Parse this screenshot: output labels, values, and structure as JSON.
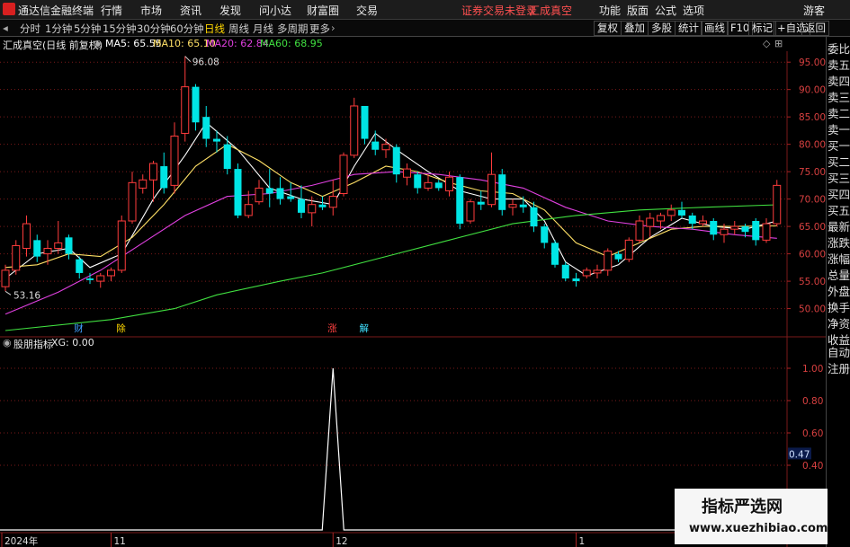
{
  "app_title": "通达信金融终端",
  "menu": [
    "行情",
    "市场",
    "资讯",
    "发现",
    "问小达",
    "财富圈",
    "交易"
  ],
  "menu_right": [
    "功能",
    "版面",
    "公式",
    "选项"
  ],
  "guest": "游客",
  "warning": "证券交易未登录",
  "stock_name_top": "汇成真空",
  "periods": [
    "分时",
    "1分钟",
    "5分钟",
    "15分钟",
    "30分钟",
    "60分钟",
    "日线",
    "周线",
    "月线",
    "多周期",
    "更多"
  ],
  "active_period": "日线",
  "right_buttons": [
    "复权",
    "叠加",
    "多股",
    "统计",
    "画线",
    "F10",
    "标记",
    "+自选",
    "返回"
  ],
  "chart_title": "汇成真空(日线 前复权)",
  "ma_legend": [
    {
      "label": "MA5: 65.55",
      "color": "#ffffff"
    },
    {
      "label": "MA10: 65.10",
      "color": "#ffe066"
    },
    {
      "label": "MA20: 62.84",
      "color": "#e040e0"
    },
    {
      "label": "MA60: 68.95",
      "color": "#40e040"
    }
  ],
  "side_panel": [
    "委比",
    "卖五",
    "卖四",
    "卖三",
    "卖二",
    "卖一",
    "买一",
    "买二",
    "买三",
    "买四",
    "买五",
    "最新",
    "涨跌",
    "涨幅",
    "总量",
    "外盘",
    "换手",
    "净资",
    "收益"
  ],
  "side_panel_lower": [
    "自动",
    "注册"
  ],
  "indicator_title": "股朋指标",
  "indicator_value": "XG: 0.00",
  "price_axis": [
    "95.00",
    "90.00",
    "85.00",
    "80.00",
    "75.00",
    "70.00",
    "65.00",
    "60.00",
    "55.00",
    "50.00"
  ],
  "indicator_axis": [
    "1.00",
    "0.80",
    "0.60",
    "0.40"
  ],
  "indicator_current": "0.47",
  "max_label": "96.08",
  "min_label": "53.16",
  "date_labels": [
    "2024年",
    "11",
    "12",
    "1"
  ],
  "event_markers": [
    {
      "text": "财",
      "color": "#40a0ff"
    },
    {
      "text": "除",
      "color": "#ffd700"
    },
    {
      "text": "涨",
      "color": "#ff4040"
    },
    {
      "text": "解",
      "color": "#40e0ff"
    }
  ],
  "watermark": {
    "line1": "指标严选网",
    "line2": "www.xuezhibiao.com"
  },
  "colors": {
    "up": "#ff3c3c",
    "down": "#00e5e5",
    "grid": "#7a1a1a"
  },
  "chart_data": {
    "type": "candlestick",
    "price_range": [
      45.5,
      97
    ],
    "candles": [
      {
        "o": 54.0,
        "h": 58.0,
        "l": 53.16,
        "c": 57.0
      },
      {
        "o": 57.0,
        "h": 62.5,
        "l": 56.2,
        "c": 61.5
      },
      {
        "o": 61.0,
        "h": 67.0,
        "l": 59.5,
        "c": 65.5
      },
      {
        "o": 62.5,
        "h": 63.5,
        "l": 58.5,
        "c": 59.5
      },
      {
        "o": 60.0,
        "h": 62.5,
        "l": 58.0,
        "c": 61.0
      },
      {
        "o": 61.0,
        "h": 66.0,
        "l": 60.0,
        "c": 62.0
      },
      {
        "o": 63.0,
        "h": 63.5,
        "l": 59.0,
        "c": 60.0
      },
      {
        "o": 59.0,
        "h": 59.5,
        "l": 55.5,
        "c": 56.5
      },
      {
        "o": 55.5,
        "h": 56.5,
        "l": 54.5,
        "c": 55.2
      },
      {
        "o": 55.0,
        "h": 56.5,
        "l": 53.8,
        "c": 56.0
      },
      {
        "o": 56.0,
        "h": 57.5,
        "l": 55.0,
        "c": 57.0
      },
      {
        "o": 57.0,
        "h": 67.0,
        "l": 56.5,
        "c": 66.0
      },
      {
        "o": 66.0,
        "h": 75.0,
        "l": 65.5,
        "c": 73.0
      },
      {
        "o": 72.0,
        "h": 74.5,
        "l": 71.0,
        "c": 73.5
      },
      {
        "o": 73.5,
        "h": 77.0,
        "l": 69.5,
        "c": 76.5
      },
      {
        "o": 76.0,
        "h": 78.5,
        "l": 71.0,
        "c": 72.0
      },
      {
        "o": 72.5,
        "h": 84.0,
        "l": 71.0,
        "c": 81.5
      },
      {
        "o": 82.0,
        "h": 96.08,
        "l": 80.5,
        "c": 90.5
      },
      {
        "o": 90.5,
        "h": 91.0,
        "l": 82.5,
        "c": 84.0
      },
      {
        "o": 85.0,
        "h": 87.0,
        "l": 79.5,
        "c": 81.0
      },
      {
        "o": 81.0,
        "h": 82.5,
        "l": 78.5,
        "c": 80.5
      },
      {
        "o": 80.0,
        "h": 81.5,
        "l": 74.5,
        "c": 75.5
      },
      {
        "o": 75.5,
        "h": 76.5,
        "l": 66.5,
        "c": 67.0
      },
      {
        "o": 67.0,
        "h": 71.5,
        "l": 66.5,
        "c": 69.0
      },
      {
        "o": 69.5,
        "h": 73.5,
        "l": 69.0,
        "c": 72.0
      },
      {
        "o": 72.0,
        "h": 75.5,
        "l": 68.5,
        "c": 71.0
      },
      {
        "o": 72.0,
        "h": 74.0,
        "l": 69.0,
        "c": 70.0
      },
      {
        "o": 70.5,
        "h": 73.0,
        "l": 69.5,
        "c": 70.0
      },
      {
        "o": 70.0,
        "h": 72.5,
        "l": 66.5,
        "c": 67.5
      },
      {
        "o": 67.5,
        "h": 70.5,
        "l": 65.0,
        "c": 69.0
      },
      {
        "o": 69.0,
        "h": 70.5,
        "l": 68.0,
        "c": 68.5
      },
      {
        "o": 68.5,
        "h": 73.5,
        "l": 67.0,
        "c": 70.5
      },
      {
        "o": 71.0,
        "h": 78.5,
        "l": 70.5,
        "c": 78.0
      },
      {
        "o": 78.0,
        "h": 88.5,
        "l": 77.5,
        "c": 87.0
      },
      {
        "o": 87.0,
        "h": 85.5,
        "l": 80.0,
        "c": 81.0
      },
      {
        "o": 80.5,
        "h": 82.5,
        "l": 78.0,
        "c": 79.0
      },
      {
        "o": 79.0,
        "h": 81.0,
        "l": 77.5,
        "c": 80.0
      },
      {
        "o": 79.5,
        "h": 80.0,
        "l": 73.0,
        "c": 74.5
      },
      {
        "o": 74.0,
        "h": 76.5,
        "l": 72.5,
        "c": 75.5
      },
      {
        "o": 74.5,
        "h": 75.0,
        "l": 71.0,
        "c": 72.0
      },
      {
        "o": 72.0,
        "h": 74.5,
        "l": 71.5,
        "c": 73.0
      },
      {
        "o": 73.0,
        "h": 73.5,
        "l": 71.5,
        "c": 72.0
      },
      {
        "o": 71.5,
        "h": 75.0,
        "l": 70.5,
        "c": 74.0
      },
      {
        "o": 74.0,
        "h": 74.5,
        "l": 64.5,
        "c": 65.5
      },
      {
        "o": 66.0,
        "h": 70.0,
        "l": 65.5,
        "c": 69.5
      },
      {
        "o": 69.5,
        "h": 71.5,
        "l": 68.0,
        "c": 69.0
      },
      {
        "o": 69.0,
        "h": 78.5,
        "l": 68.5,
        "c": 74.5
      },
      {
        "o": 74.5,
        "h": 75.5,
        "l": 67.0,
        "c": 68.0
      },
      {
        "o": 68.5,
        "h": 70.0,
        "l": 67.0,
        "c": 69.0
      },
      {
        "o": 69.0,
        "h": 70.5,
        "l": 67.5,
        "c": 68.5
      },
      {
        "o": 68.5,
        "h": 69.5,
        "l": 64.0,
        "c": 65.0
      },
      {
        "o": 65.0,
        "h": 65.5,
        "l": 61.0,
        "c": 62.0
      },
      {
        "o": 62.0,
        "h": 62.5,
        "l": 57.5,
        "c": 58.0
      },
      {
        "o": 58.0,
        "h": 58.5,
        "l": 55.0,
        "c": 55.5
      },
      {
        "o": 55.5,
        "h": 56.5,
        "l": 54.0,
        "c": 55.0
      },
      {
        "o": 56.0,
        "h": 57.5,
        "l": 55.5,
        "c": 57.0
      },
      {
        "o": 56.5,
        "h": 58.0,
        "l": 55.5,
        "c": 57.0
      },
      {
        "o": 57.0,
        "h": 61.0,
        "l": 56.0,
        "c": 60.5
      },
      {
        "o": 60.0,
        "h": 60.5,
        "l": 58.5,
        "c": 59.0
      },
      {
        "o": 59.0,
        "h": 63.0,
        "l": 58.5,
        "c": 62.5
      },
      {
        "o": 62.5,
        "h": 67.0,
        "l": 62.0,
        "c": 66.0
      },
      {
        "o": 65.0,
        "h": 67.5,
        "l": 63.0,
        "c": 66.5
      },
      {
        "o": 66.0,
        "h": 67.5,
        "l": 64.5,
        "c": 67.0
      },
      {
        "o": 67.0,
        "h": 69.0,
        "l": 66.0,
        "c": 68.0
      },
      {
        "o": 68.0,
        "h": 69.5,
        "l": 66.5,
        "c": 67.0
      },
      {
        "o": 67.0,
        "h": 67.5,
        "l": 64.5,
        "c": 65.5
      },
      {
        "o": 65.5,
        "h": 67.0,
        "l": 65.0,
        "c": 66.0
      },
      {
        "o": 66.0,
        "h": 66.5,
        "l": 62.5,
        "c": 63.5
      },
      {
        "o": 63.5,
        "h": 65.5,
        "l": 62.0,
        "c": 64.5
      },
      {
        "o": 64.5,
        "h": 66.0,
        "l": 63.5,
        "c": 65.0
      },
      {
        "o": 65.0,
        "h": 65.5,
        "l": 63.0,
        "c": 64.0
      },
      {
        "o": 66.0,
        "h": 66.5,
        "l": 61.5,
        "c": 62.5
      },
      {
        "o": 62.5,
        "h": 66.5,
        "l": 62.0,
        "c": 65.5
      },
      {
        "o": 65.5,
        "h": 73.5,
        "l": 65.0,
        "c": 72.5
      }
    ],
    "ma_lines": [
      {
        "name": "MA5",
        "color": "#ffffff",
        "points": [
          [
            0,
            55.5
          ],
          [
            3,
            60
          ],
          [
            6,
            61
          ],
          [
            8,
            57.5
          ],
          [
            11,
            60
          ],
          [
            14,
            70
          ],
          [
            17,
            78
          ],
          [
            19,
            84
          ],
          [
            22,
            79
          ],
          [
            25,
            72
          ],
          [
            28,
            70
          ],
          [
            31,
            69
          ],
          [
            33,
            76
          ],
          [
            35,
            82
          ],
          [
            37,
            79
          ],
          [
            40,
            75
          ],
          [
            43,
            71.5
          ],
          [
            46,
            70
          ],
          [
            49,
            70
          ],
          [
            51,
            66
          ],
          [
            53,
            58.5
          ],
          [
            55,
            56
          ],
          [
            58,
            58
          ],
          [
            61,
            63
          ],
          [
            64,
            66.5
          ],
          [
            67,
            65
          ],
          [
            70,
            64.5
          ],
          [
            73,
            66
          ]
        ]
      },
      {
        "name": "MA10",
        "color": "#ffe066",
        "points": [
          [
            0,
            57.5
          ],
          [
            3,
            58
          ],
          [
            6,
            60
          ],
          [
            9,
            59.5
          ],
          [
            12,
            63
          ],
          [
            15,
            69
          ],
          [
            18,
            76
          ],
          [
            21,
            80
          ],
          [
            24,
            77
          ],
          [
            27,
            73
          ],
          [
            30,
            70.5
          ],
          [
            33,
            73
          ],
          [
            36,
            76
          ],
          [
            39,
            75
          ],
          [
            42,
            73
          ],
          [
            45,
            71.5
          ],
          [
            48,
            71
          ],
          [
            51,
            68
          ],
          [
            54,
            62
          ],
          [
            57,
            59.5
          ],
          [
            60,
            62
          ],
          [
            63,
            64.5
          ],
          [
            66,
            65
          ],
          [
            69,
            65
          ],
          [
            73,
            65.1
          ]
        ]
      },
      {
        "name": "MA20",
        "color": "#e040e0",
        "points": [
          [
            0,
            49
          ],
          [
            5,
            53
          ],
          [
            9,
            57
          ],
          [
            13,
            62
          ],
          [
            17,
            67
          ],
          [
            21,
            70.5
          ],
          [
            25,
            71
          ],
          [
            29,
            72.5
          ],
          [
            33,
            74.5
          ],
          [
            37,
            75
          ],
          [
            41,
            74.5
          ],
          [
            45,
            73.5
          ],
          [
            49,
            72
          ],
          [
            53,
            68.5
          ],
          [
            57,
            66
          ],
          [
            61,
            65
          ],
          [
            65,
            64.5
          ],
          [
            69,
            63.5
          ],
          [
            73,
            62.84
          ]
        ]
      },
      {
        "name": "MA60",
        "color": "#40e040",
        "points": [
          [
            0,
            46
          ],
          [
            10,
            48
          ],
          [
            16,
            50
          ],
          [
            20,
            52.5
          ],
          [
            26,
            55
          ],
          [
            30,
            56.5
          ],
          [
            36,
            59.5
          ],
          [
            42,
            62.5
          ],
          [
            48,
            65.5
          ],
          [
            54,
            67
          ],
          [
            60,
            68
          ],
          [
            66,
            68.5
          ],
          [
            73,
            68.95
          ]
        ]
      }
    ],
    "indicator": {
      "name": "XG",
      "spike_index": 31,
      "spike_value": 1.0,
      "range": [
        0,
        1.1
      ]
    }
  }
}
